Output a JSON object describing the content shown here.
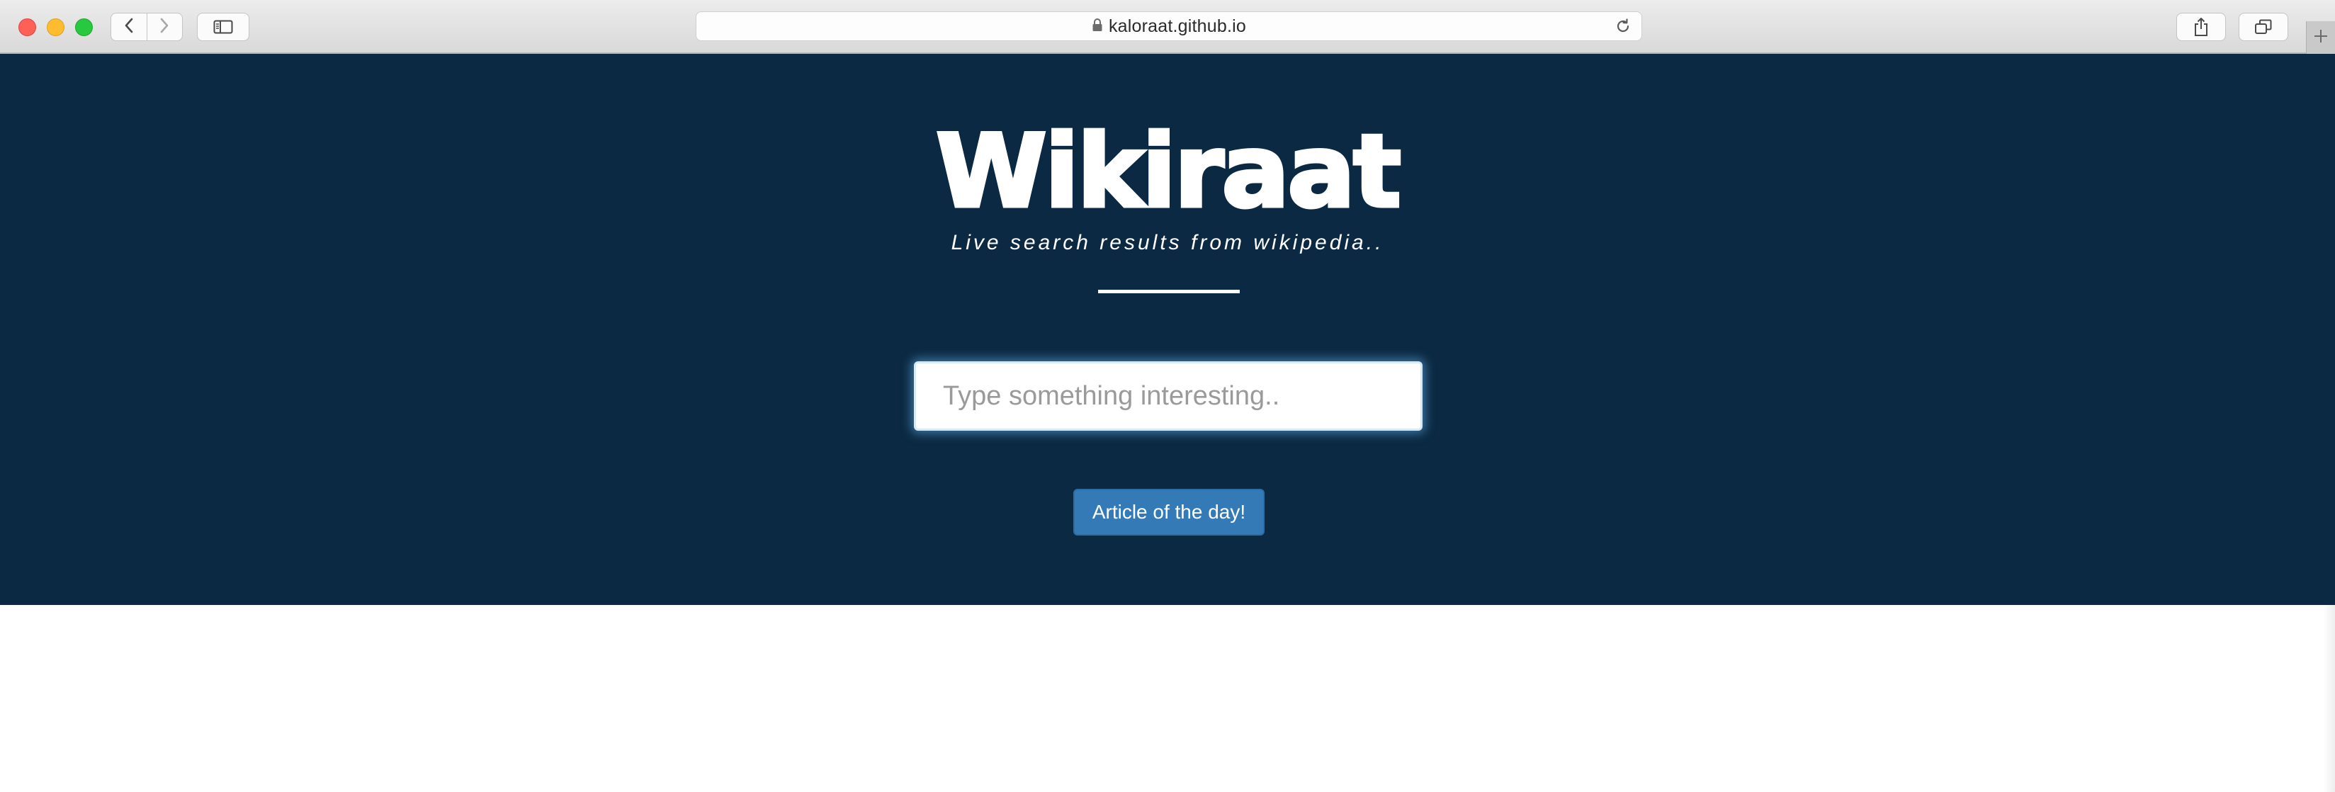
{
  "browser": {
    "url": "kaloraat.github.io",
    "icons": {
      "back": "chevron-left-icon",
      "forward": "chevron-right-icon",
      "sidebar": "sidebar-icon",
      "lock": "lock-icon",
      "reload": "reload-icon",
      "share": "share-icon",
      "tabs": "tabs-overview-icon",
      "new_tab": "plus-icon"
    }
  },
  "page": {
    "logo": "Wikiraat",
    "tagline": "Live search results from wikipedia..",
    "search": {
      "placeholder": "Type something interesting..",
      "value": ""
    },
    "article_button_label": "Article of the day!",
    "colors": {
      "hero_background": "#0b2942",
      "button_primary": "#337ab7",
      "text": "#ffffff"
    }
  }
}
